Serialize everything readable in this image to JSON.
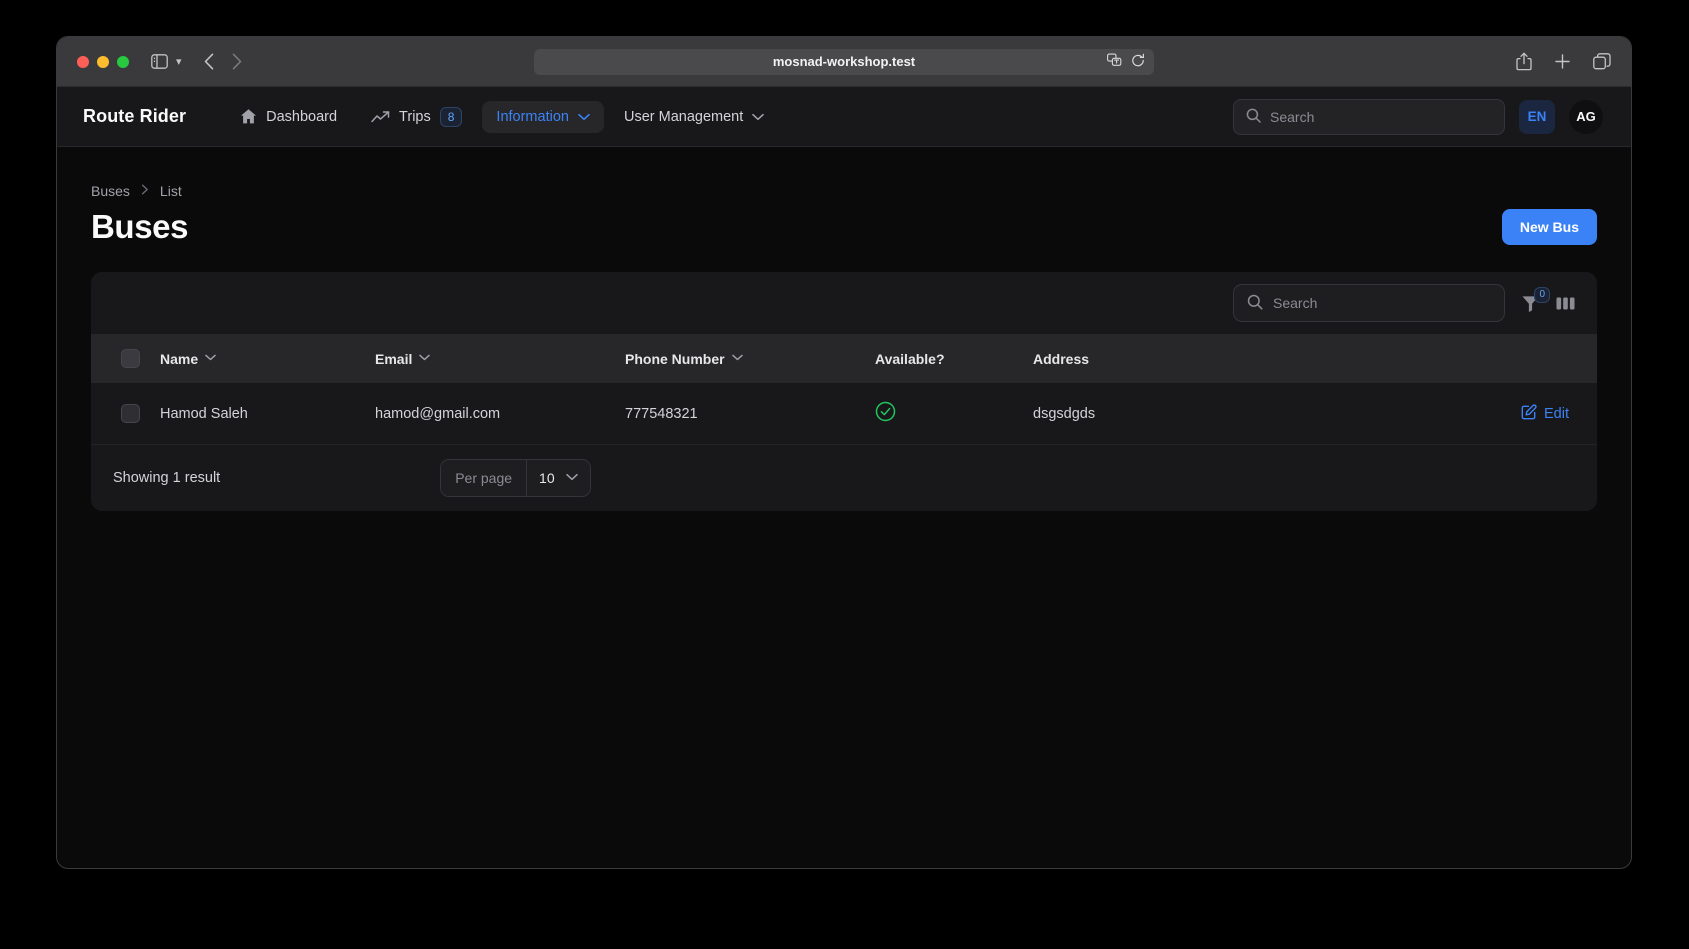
{
  "browser": {
    "url": "mosnad-workshop.test",
    "icons": {
      "sidebar": "sidebar-icon",
      "chevron_down": "chevron-down-icon",
      "back": "back-arrow-icon",
      "forward": "forward-arrow-icon",
      "translate": "translate-icon",
      "reload": "reload-icon",
      "share": "share-icon",
      "new_tab": "plus-icon",
      "tabs": "tab-overview-icon"
    }
  },
  "appnav": {
    "brand": "Route Rider",
    "items": [
      {
        "label": "Dashboard",
        "icon": "home-icon",
        "badge": null,
        "has_chevron": false,
        "active": false
      },
      {
        "label": "Trips",
        "icon": "trending-up-icon",
        "badge": "8",
        "has_chevron": false,
        "active": false
      },
      {
        "label": "Information",
        "icon": null,
        "badge": null,
        "has_chevron": true,
        "active": true
      },
      {
        "label": "User Management",
        "icon": null,
        "badge": null,
        "has_chevron": true,
        "active": false
      }
    ],
    "search_placeholder": "Search",
    "language": "EN",
    "avatar_initials": "AG"
  },
  "page": {
    "breadcrumb": [
      "Buses",
      "List"
    ],
    "title": "Buses",
    "new_button": "New Bus"
  },
  "table": {
    "search_placeholder": "Search",
    "filter_count": "0",
    "columns": [
      {
        "label": "Name",
        "sortable": true
      },
      {
        "label": "Email",
        "sortable": true
      },
      {
        "label": "Phone Number",
        "sortable": true
      },
      {
        "label": "Available?",
        "sortable": false
      },
      {
        "label": "Address",
        "sortable": false
      }
    ],
    "rows": [
      {
        "name": "Hamod Saleh",
        "email": "hamod@gmail.com",
        "phone": "777548321",
        "available": true,
        "address": "dsgsdgds",
        "action": "Edit"
      }
    ],
    "footer": {
      "showing": "Showing 1 result",
      "per_page_label": "Per page",
      "per_page_value": "10"
    }
  },
  "colors": {
    "accent": "#3b82f6",
    "success": "#22c55e",
    "card_bg": "#18181b",
    "header_bg": "#27272a",
    "page_bg": "#0a0a0b"
  }
}
